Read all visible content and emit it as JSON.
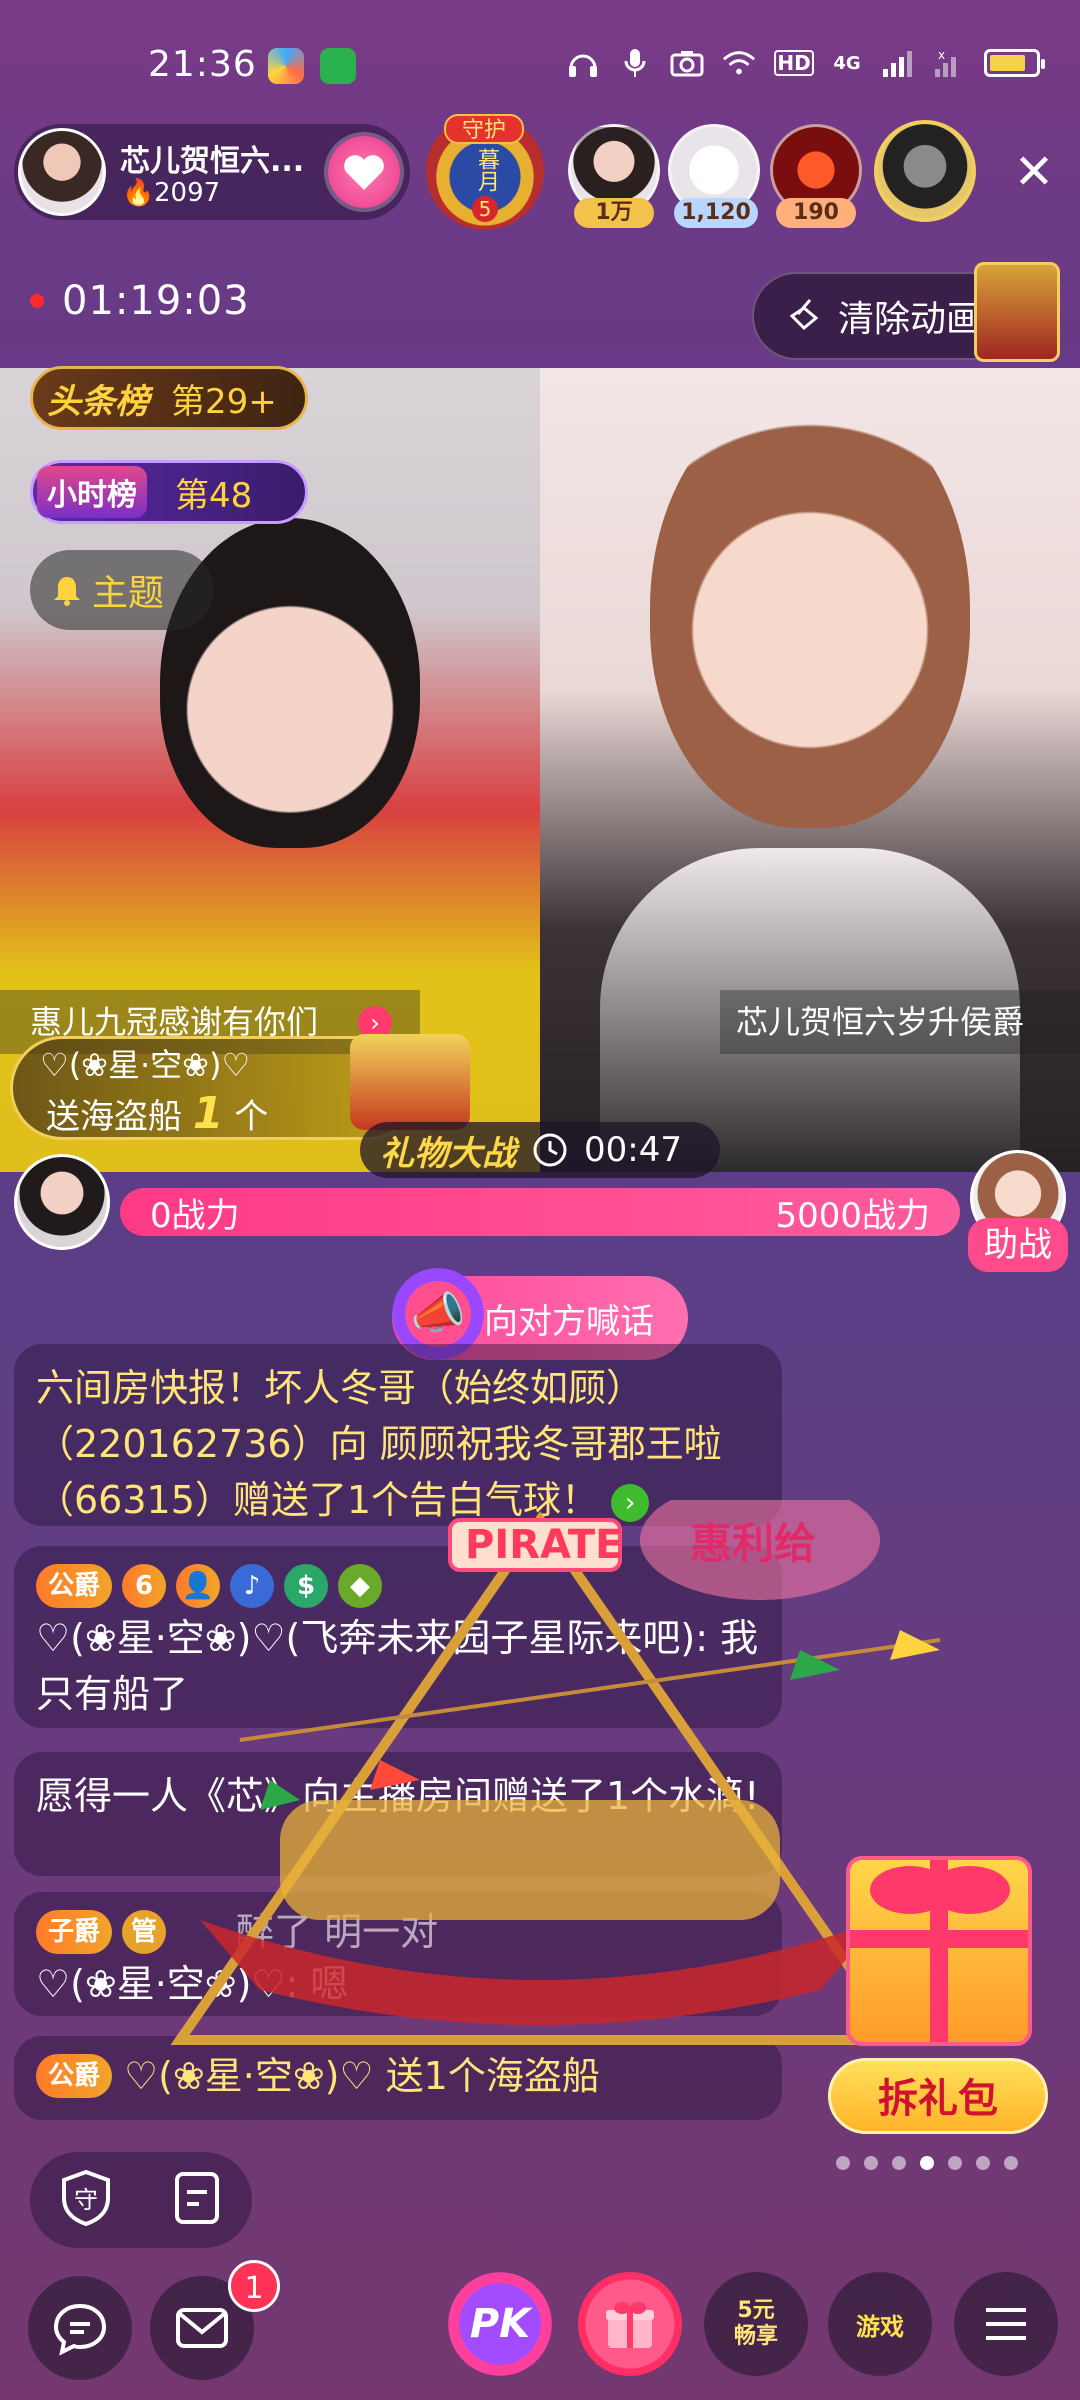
{
  "status_bar": {
    "time": "21:36",
    "network": "4G",
    "hd": "HD",
    "battery_level": 0.8,
    "icons": [
      "headphones-icon",
      "mic-icon",
      "camera-icon",
      "wifi-icon",
      "signal-icon",
      "battery-icon"
    ]
  },
  "host": {
    "name": "芯儿贺恒六...",
    "heat": "2097",
    "follow_icon": "heart-icon"
  },
  "guard": {
    "label": "守护",
    "sub": "暮月",
    "level": "5"
  },
  "viewers": [
    {
      "count": "1万",
      "color": "#f2c24a"
    },
    {
      "count": "1,120",
      "color": "#b8d6ff"
    },
    {
      "count": "190",
      "color": "#ffb07a"
    }
  ],
  "close_label": "✕",
  "live_timer": "01:19:03",
  "clear_animation_label": "清除动画",
  "ranks": {
    "headline_tag": "头条榜",
    "headline_rank": "第29+",
    "hourly_tag": "小时榜",
    "hourly_rank": "第48",
    "topic": "主题"
  },
  "video": {
    "left_caption": "惠儿九冠感谢有你们",
    "right_caption": "芯儿贺恒六岁升侯爵"
  },
  "gift_toast": {
    "user": "♡(❀星·空❀)♡",
    "send_prefix": "送海盗船",
    "count": "1",
    "unit": "个"
  },
  "battle": {
    "title": "礼物大战",
    "countdown": "00:47"
  },
  "power": {
    "left": "0战力",
    "right": "5000战力",
    "help": "助战"
  },
  "shout_label": "向对方喊话",
  "chat": {
    "announce": "六间房快报！坏人冬哥（始终如顾）（220162736）向 顾顾祝我冬哥郡王啦（66315）赠送了1个告白气球！",
    "msg1_badge": "公爵",
    "msg1_text": "♡(❀星·空❀)♡(飞奔未来园子星际来吧): 我只有船了",
    "msg2_text": "愿得一人《芯》向主播房间赠送了1个水滴!",
    "msg3_badge": "子爵",
    "msg3_badge2": "管",
    "msg3_extra": "醉了 明一对",
    "msg3_text": "♡(❀星·空❀)♡: 嗯",
    "msg4_badge": "公爵",
    "msg4_text": "♡(❀星·空❀)♡ 送1个海盗船"
  },
  "overlay": {
    "pirate_label": "PIRATE",
    "watermark": "惠利给"
  },
  "unbox_label": "拆礼包",
  "pager": {
    "count": 7,
    "active": 3
  },
  "bottom": {
    "mail_badge": "1",
    "pk_label": "PK",
    "share_label": "5元\n畅享",
    "game_label": "游戏"
  }
}
